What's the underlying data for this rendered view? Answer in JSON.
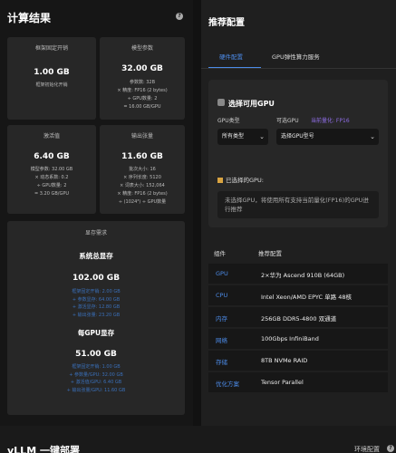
{
  "left": {
    "title": "计算结果",
    "cards": {
      "framework": {
        "header": "框架固定开销",
        "value": "1.00 GB",
        "desc": [
          "框架初始化开销"
        ]
      },
      "params": {
        "header": "模型参数",
        "value": "32.00 GB",
        "desc": [
          "参数数: 32B",
          "× 精度: FP16 (2 bytes)",
          "÷ GPU数量: 2",
          "= 16.00 GB/GPU"
        ]
      },
      "activation": {
        "header": "激活值",
        "value": "6.40 GB",
        "desc": [
          "模型参数: 32.00 GB",
          "× 动态系数: 0.2",
          "÷ GPU数量: 2",
          "= 3.20 GB/GPU"
        ]
      },
      "output": {
        "header": "输出张量",
        "value": "11.60 GB",
        "desc": [
          "批次大小: 16",
          "× 序列长度: 5120",
          "× 词表大小: 152,064",
          "× 精度: FP16 (2 bytes)",
          "÷ (1024³) ÷ GPU数量"
        ]
      }
    },
    "memory": {
      "header": "显存需求",
      "system": {
        "title": "系统总显存",
        "value": "102.00 GB",
        "lines": [
          "框架固定开销: 2.00 GB",
          "+ 参数显存: 64.00 GB",
          "+ 激活显存: 12.80 GB",
          "+ 输出张量: 23.20 GB"
        ]
      },
      "per_gpu": {
        "title": "每GPU显存",
        "value": "51.00 GB",
        "lines": [
          "框架固定开销: 1.00 GB",
          "+ 参数量/GPU: 32.00 GB",
          "+ 激活值/GPU: 6.40 GB",
          "+ 输出张量/GPU: 11.60 GB"
        ]
      }
    }
  },
  "right": {
    "title": "推荐配置",
    "tabs": [
      "硬件配置",
      "GPU弹性算力服务"
    ],
    "gpu_box": {
      "title": "选择可用GPU",
      "type_label": "GPU类型",
      "gpu_label": "可选GPU",
      "precision_hint": "当前量化: FP16",
      "type_value": "所有类型",
      "gpu_value": "选择GPU型号",
      "selected_label": "已选择的GPU:",
      "note": "未选择GPU，将使用所有支持当前量化(FP16)的GPU进行推荐"
    },
    "table": {
      "headers": [
        "组件",
        "推荐配置"
      ],
      "rows": [
        {
          "k": "GPU",
          "v": "2×华为 Ascend 910B (64GB)"
        },
        {
          "k": "CPU",
          "v": "Intel Xeon/AMD EPYC 单路 48核"
        },
        {
          "k": "内存",
          "v": "256GB DDR5-4800 双通道"
        },
        {
          "k": "网络",
          "v": "100Gbps InfiniBand"
        },
        {
          "k": "存储",
          "v": "8TB NVMe RAID"
        },
        {
          "k": "优化方案",
          "v": "Tensor Parallel"
        }
      ]
    }
  },
  "bottom": {
    "title": "vLLM 一键部署",
    "link": "环境配置"
  },
  "icons": {
    "help": "help-icon",
    "gpu": "gpu-icon",
    "chevron": "chevron-down-icon",
    "selected": "gpu-selected-icon"
  }
}
